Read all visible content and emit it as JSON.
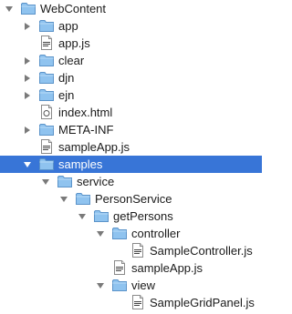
{
  "tree": {
    "rows": [
      {
        "label": "WebContent",
        "kind": "folder",
        "depth": 0,
        "expanded": true,
        "selected": false
      },
      {
        "label": "app",
        "kind": "folder",
        "depth": 1,
        "expanded": false,
        "selected": false
      },
      {
        "label": "app.js",
        "kind": "file-js",
        "depth": 1,
        "expanded": null,
        "selected": false
      },
      {
        "label": "clear",
        "kind": "folder",
        "depth": 1,
        "expanded": false,
        "selected": false
      },
      {
        "label": "djn",
        "kind": "folder",
        "depth": 1,
        "expanded": false,
        "selected": false
      },
      {
        "label": "ejn",
        "kind": "folder",
        "depth": 1,
        "expanded": false,
        "selected": false
      },
      {
        "label": "index.html",
        "kind": "file-html",
        "depth": 1,
        "expanded": null,
        "selected": false
      },
      {
        "label": "META-INF",
        "kind": "folder",
        "depth": 1,
        "expanded": false,
        "selected": false
      },
      {
        "label": "sampleApp.js",
        "kind": "file-js",
        "depth": 1,
        "expanded": null,
        "selected": false
      },
      {
        "label": "samples",
        "kind": "folder",
        "depth": 1,
        "expanded": true,
        "selected": true
      },
      {
        "label": "service",
        "kind": "folder",
        "depth": 2,
        "expanded": true,
        "selected": false
      },
      {
        "label": "PersonService",
        "kind": "folder",
        "depth": 3,
        "expanded": true,
        "selected": false
      },
      {
        "label": "getPersons",
        "kind": "folder",
        "depth": 4,
        "expanded": true,
        "selected": false
      },
      {
        "label": "controller",
        "kind": "folder",
        "depth": 5,
        "expanded": true,
        "selected": false
      },
      {
        "label": "SampleController.js",
        "kind": "file-js",
        "depth": 6,
        "expanded": null,
        "selected": false
      },
      {
        "label": "sampleApp.js",
        "kind": "file-js",
        "depth": 5,
        "expanded": null,
        "selected": false
      },
      {
        "label": "view",
        "kind": "folder",
        "depth": 5,
        "expanded": true,
        "selected": false
      },
      {
        "label": "SampleGridPanel.js",
        "kind": "file-js",
        "depth": 6,
        "expanded": null,
        "selected": false
      }
    ]
  },
  "colors": {
    "selection": "#3875d7",
    "folder_fill": "#8fc3ef",
    "folder_edge": "#5b93c9",
    "disclosure": "#7a7a7a"
  }
}
